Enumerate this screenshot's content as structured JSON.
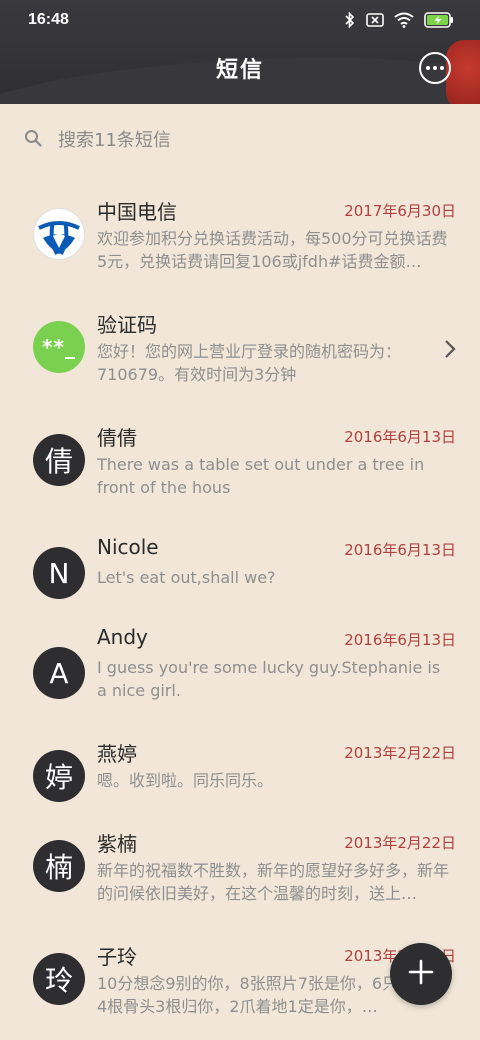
{
  "status_bar": {
    "time": "16:48",
    "icons": [
      "bluetooth-icon",
      "sim-off-icon",
      "wifi-icon",
      "battery-charging-icon"
    ]
  },
  "header": {
    "title": "短信",
    "more_icon": "more-icon"
  },
  "search": {
    "placeholder": "搜索11条短信",
    "icon": "search-icon"
  },
  "colors": {
    "accent_date": "#b0413e",
    "avatar_bg": "#2e2e30",
    "background": "#f1e6d8",
    "code_avatar": "#79d14f"
  },
  "messages": [
    {
      "name": "中国电信",
      "date": "2017年6月30日",
      "avatar": "telecom-logo",
      "preview": "欢迎参加积分兑换话费活动，每500分可兑换话费5元，兑换话费请回复106或jfdh#话费金额…"
    },
    {
      "name": "验证码",
      "date": "",
      "avatar": "**_",
      "preview": "您好！您的网上营业厅登录的随机密码为：710679。有效时间为3分钟"
    },
    {
      "name": "倩倩",
      "date": "2016年6月13日",
      "avatar": "倩",
      "preview": "There was a table set out under a tree in front of the hous"
    },
    {
      "name": "Nicole",
      "date": "2016年6月13日",
      "avatar": "N",
      "preview": "Let's eat out,shall we?"
    },
    {
      "name": "Andy",
      "date": "2016年6月13日",
      "avatar": "A",
      "preview": "I guess you're some lucky guy.Stephanie is a nice girl."
    },
    {
      "name": "燕婷",
      "date": "2013年2月22日",
      "avatar": "婷",
      "preview": "嗯。收到啦。同乐同乐。"
    },
    {
      "name": "紫楠",
      "date": "2013年2月22日",
      "avatar": "楠",
      "preview": "新年的祝福数不胜数，新年的愿望好多好多，新年的问候依旧美好，在这个温馨的时刻，送上…"
    },
    {
      "name": "子玲",
      "date": "2013年2月22日",
      "avatar": "玲",
      "preview": "10分想念9别的你，8张照片7张是你，6只像你，4根骨头3根归你，2爪着地1定是你，…"
    }
  ],
  "fab": {
    "icon": "plus-icon"
  }
}
